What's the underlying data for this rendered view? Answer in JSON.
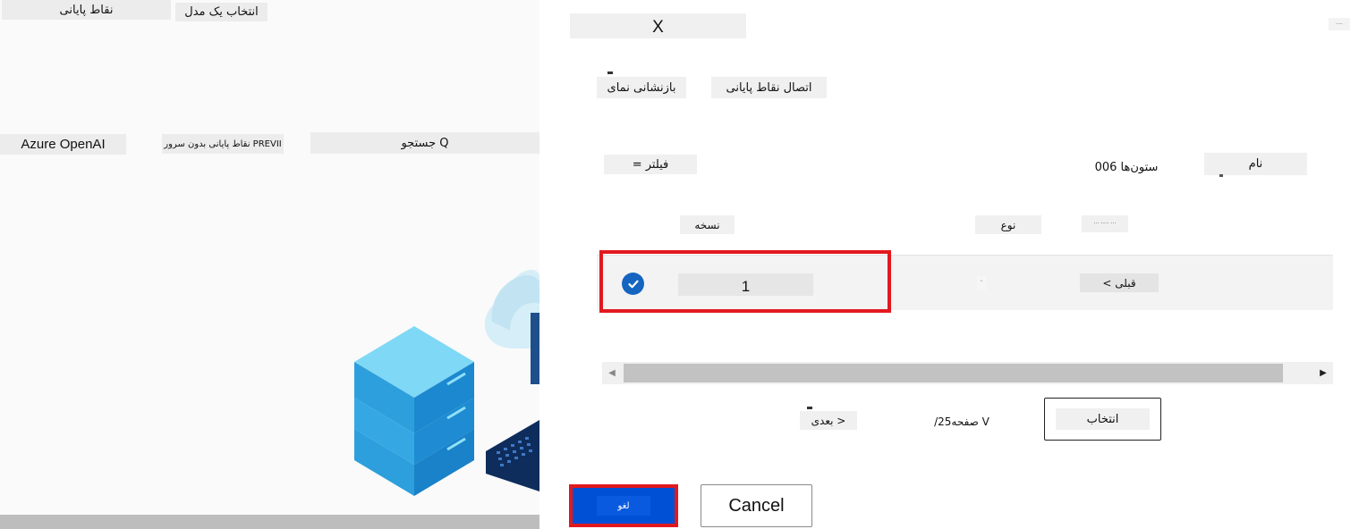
{
  "background": {
    "header": {
      "endpoints_label": "نقاط پایانی",
      "select_model_label": "انتخاب یک مدل"
    },
    "filters": {
      "azure_openai_label": "Azure OpenAI",
      "serverless_label": "نقاط پایانی بدون سرور PREVII",
      "search_label": "جستجو Q"
    }
  },
  "panel": {
    "close_label": "X",
    "corner_mark": "····",
    "tabs": [
      {
        "label": "اتصال نقاط پایانی"
      },
      {
        "label": "بازنشانی نمای"
      }
    ],
    "filter_label": "= فیلتر",
    "columns_count_label": "006 ستون‌ها",
    "name_label": "نام",
    "table": {
      "headers": {
        "version": "نسخه",
        "type": "نوع",
        "sort": "··· ····· ···"
      },
      "rows": [
        {
          "selected": true,
          "version": "1",
          "type": "¨",
          "previous": "< قبلی"
        }
      ]
    },
    "pagination": {
      "next_label": "بعدی >",
      "page_label": "/25صفحه V",
      "select_label": "انتخاب"
    },
    "footer": {
      "cancel_fa_label": "لغو",
      "cancel_label": "Cancel"
    }
  },
  "colors": {
    "primary": "#0050d6",
    "highlight": "#e1191f",
    "check": "#1565c0"
  }
}
